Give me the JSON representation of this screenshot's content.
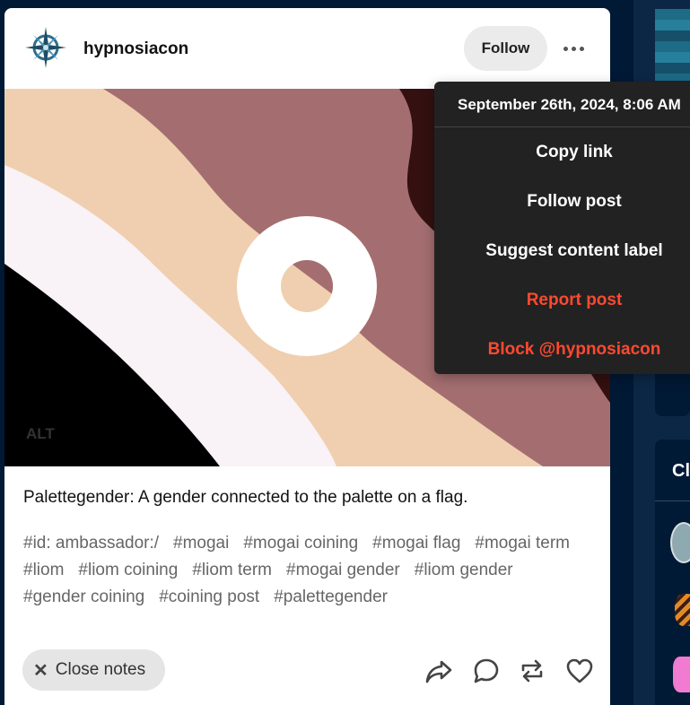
{
  "post": {
    "blog_name": "hypnosiacon",
    "follow_label": "Follow",
    "alt_label": "ALT",
    "text": "Palettegender: A gender connected to the palette on a flag.",
    "tags": [
      "#id: ambassador:/",
      "#mogai",
      "#mogai coining",
      "#mogai flag",
      "#mogai term",
      "#liom",
      "#liom coining",
      "#liom term",
      "#mogai gender",
      "#liom gender",
      "#gender coining",
      "#coining post",
      "#palettegender"
    ],
    "close_notes_label": "Close notes"
  },
  "menu": {
    "timestamp": "September 26th, 2024, 8:06 AM",
    "items": [
      {
        "label": "Copy link"
      },
      {
        "label": "Follow post"
      },
      {
        "label": "Suggest content label"
      },
      {
        "label": "Report post"
      },
      {
        "label": "Block @hypnosiacon"
      }
    ]
  },
  "sidebar": {
    "heading_fragment": "Cl"
  },
  "colors": {
    "background": "#001935",
    "menu_bg": "#222222",
    "danger": "#ff4930",
    "flag": [
      "#000000",
      "#f9f2f6",
      "#efcfaf",
      "#a46e70",
      "#341010"
    ]
  }
}
